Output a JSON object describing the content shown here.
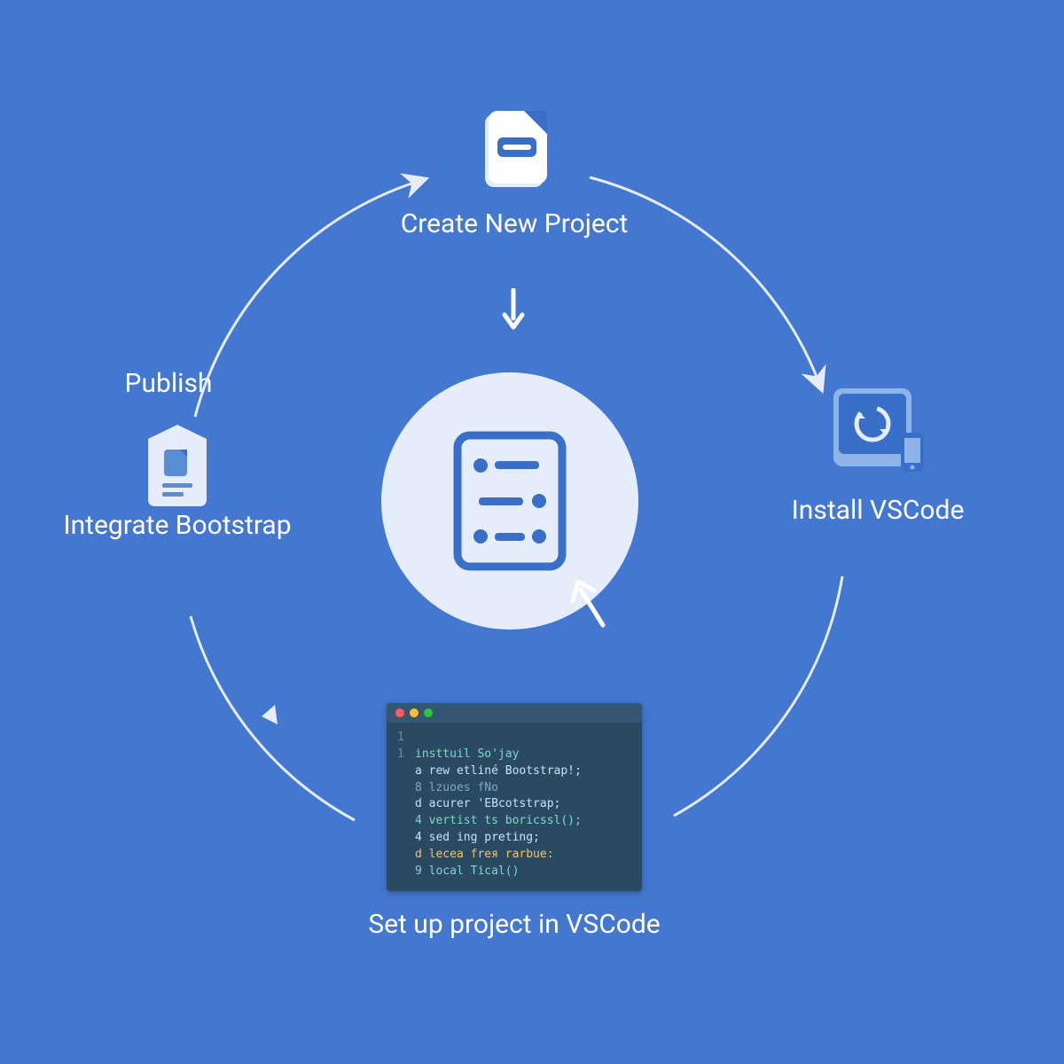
{
  "center_icon": "list-settings-icon",
  "steps": {
    "top": {
      "label": "Create New Project",
      "icon": "document-icon"
    },
    "right": {
      "label": "Install VSCode",
      "icon": "device-sync-icon"
    },
    "bottom": {
      "label": "Set up project in VSCode",
      "icon": "code-editor-window"
    },
    "left_bootstrap": {
      "label": "Integrate Bootstrap",
      "icon": "file-icon"
    },
    "left_publish": {
      "label": "Publish"
    }
  },
  "code_lines": [
    {
      "n": "1",
      "text": ""
    },
    {
      "n": "1",
      "text": "insttuil So'jay"
    },
    {
      "n": "",
      "text": "a rew etliné Bootstrap!;"
    },
    {
      "n": "",
      "text": "8 lzuoes fNo"
    },
    {
      "n": "",
      "text": "d acurer 'EBcotstrap;"
    },
    {
      "n": "",
      "text": "4 vertist ts boricssl();"
    },
    {
      "n": "",
      "text": "4 sed ing preting;"
    },
    {
      "n": "",
      "text": "d lecea freя rarbue:"
    },
    {
      "n": "",
      "text": "9 local Tical()"
    }
  ],
  "colors": {
    "bg": "#4478d0",
    "light": "#e4edf9",
    "white": "#ffffff",
    "icon_blue": "#3a6fc9",
    "code_bg": "#2a4a64"
  }
}
